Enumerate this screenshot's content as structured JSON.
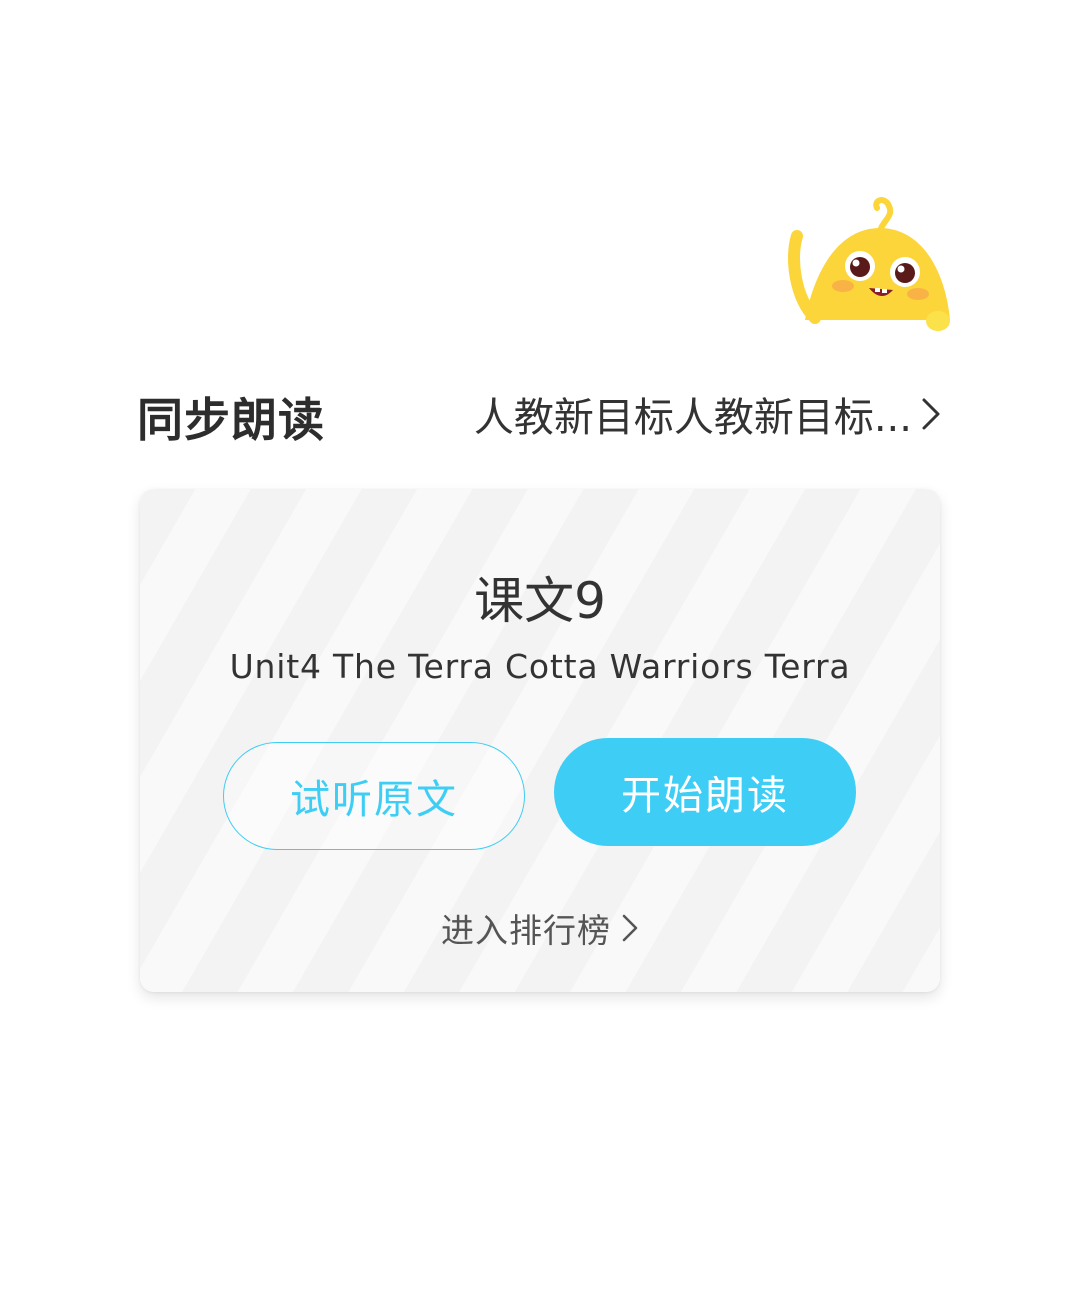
{
  "header": {
    "section_title": "同步朗读",
    "book_name": "人教新目标人教新目标..."
  },
  "lesson": {
    "title": "课文9",
    "subtitle": "Unit4 The Terra Cotta Warriors Terra"
  },
  "actions": {
    "listen_label": "试听原文",
    "read_label": "开始朗读",
    "ranking_label": "进入排行榜"
  },
  "icons": {
    "mascot": "yellow-mascot-icon",
    "book_chevron": "chevron-right-icon",
    "ranking_chevron": "chevron-right-icon"
  },
  "colors": {
    "accent": "#3ecdf5",
    "mascot_yellow": "#fcd53a"
  }
}
